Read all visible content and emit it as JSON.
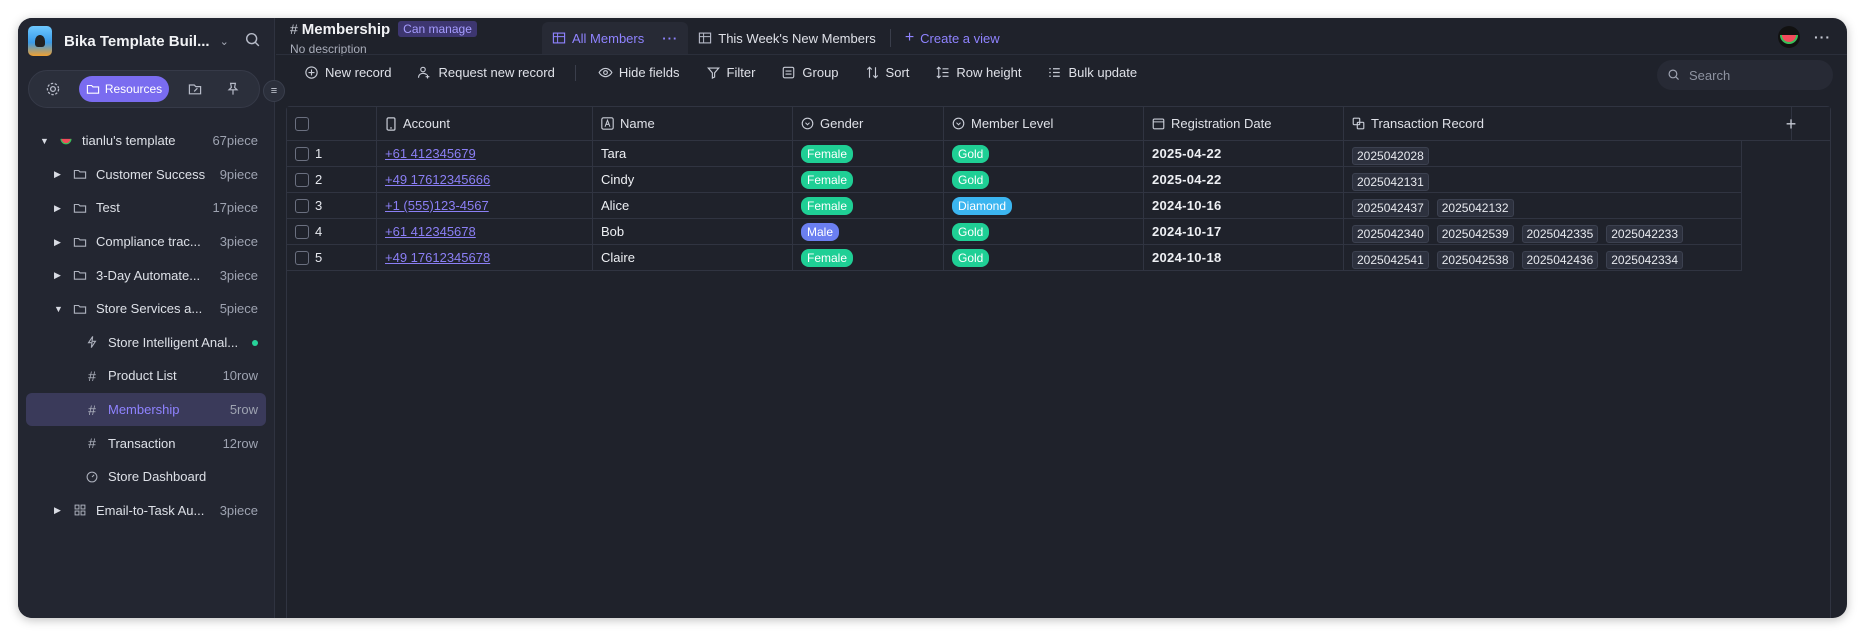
{
  "colors": {
    "accent": "#8f83ff",
    "female": "#1fcf95",
    "male": "#6b7ff0",
    "gold": "#1fcf95",
    "diamond": "#3bb5f0",
    "link": "#8b7ff5"
  },
  "sidebar": {
    "workspace_name": "Bika Template Buil...",
    "tabs": [
      {
        "icon": "gear-icon"
      },
      {
        "icon": "folder-icon",
        "label": "Resources"
      },
      {
        "icon": "share-icon"
      },
      {
        "icon": "pin-icon"
      }
    ],
    "tree": [
      {
        "label": "tianlu's template",
        "count": "67piece",
        "indent": 0,
        "tri": "down",
        "icon": "watermelon-icon"
      },
      {
        "label": "Customer Success",
        "count": "9piece",
        "indent": 1,
        "tri": "right",
        "icon": "folder-icon"
      },
      {
        "label": "Test",
        "count": "17piece",
        "indent": 1,
        "tri": "right",
        "icon": "folder-icon"
      },
      {
        "label": "Compliance trac...",
        "count": "3piece",
        "indent": 1,
        "tri": "right",
        "icon": "folder-icon"
      },
      {
        "label": "3-Day Automate...",
        "count": "3piece",
        "indent": 1,
        "tri": "right",
        "icon": "folder-icon"
      },
      {
        "label": "Store Services a...",
        "count": "5piece",
        "indent": 1,
        "tri": "down",
        "icon": "folder-icon"
      },
      {
        "label": "Store Intelligent Anal...",
        "count": "",
        "indent": 2,
        "tri": "",
        "icon": "automation-icon",
        "dot": true
      },
      {
        "label": "Product List",
        "count": "10row",
        "indent": 2,
        "tri": "",
        "icon": "hash-icon"
      },
      {
        "label": "Membership",
        "count": "5row",
        "indent": 2,
        "tri": "",
        "icon": "hash-icon",
        "selected": true
      },
      {
        "label": "Transaction",
        "count": "12row",
        "indent": 2,
        "tri": "",
        "icon": "hash-icon"
      },
      {
        "label": "Store Dashboard",
        "count": "",
        "indent": 2,
        "tri": "",
        "icon": "gauge-icon"
      },
      {
        "label": "Email-to-Task Au...",
        "count": "3piece",
        "indent": 1,
        "tri": "right",
        "icon": "grid-icon"
      }
    ]
  },
  "header": {
    "title": "Membership",
    "permission": "Can manage",
    "description": "No description"
  },
  "views": {
    "tabs": [
      {
        "label": "All Members",
        "active": true
      },
      {
        "label": "This Week's New Members",
        "active": false
      }
    ],
    "create_label": "Create a view"
  },
  "toolbar": {
    "new_record": "New record",
    "request_record": "Request new record",
    "hide_fields": "Hide fields",
    "filter": "Filter",
    "group": "Group",
    "sort": "Sort",
    "row_height": "Row height",
    "bulk_update": "Bulk update",
    "search_placeholder": "Search"
  },
  "table": {
    "columns": [
      "Account",
      "Name",
      "Gender",
      "Member Level",
      "Registration Date",
      "Transaction Record"
    ],
    "rows": [
      {
        "num": "1",
        "account": "+61 412345679",
        "name": "Tara",
        "gender": "Female",
        "level": "Gold",
        "date": "2025-04-22",
        "transactions": [
          "2025042028"
        ]
      },
      {
        "num": "2",
        "account": "+49 17612345666",
        "name": "Cindy",
        "gender": "Female",
        "level": "Gold",
        "date": "2025-04-22",
        "transactions": [
          "2025042131"
        ]
      },
      {
        "num": "3",
        "account": "+1 (555)123-4567",
        "name": "Alice",
        "gender": "Female",
        "level": "Diamond",
        "date": "2024-10-16",
        "transactions": [
          "2025042437",
          "2025042132"
        ]
      },
      {
        "num": "4",
        "account": "+61 412345678",
        "name": "Bob",
        "gender": "Male",
        "level": "Gold",
        "date": "2024-10-17",
        "transactions": [
          "2025042340",
          "2025042539",
          "2025042335",
          "2025042233"
        ]
      },
      {
        "num": "5",
        "account": "+49 17612345678",
        "name": "Claire",
        "gender": "Female",
        "level": "Gold",
        "date": "2024-10-18",
        "transactions": [
          "2025042541",
          "2025042538",
          "2025042436",
          "2025042334"
        ]
      }
    ]
  }
}
